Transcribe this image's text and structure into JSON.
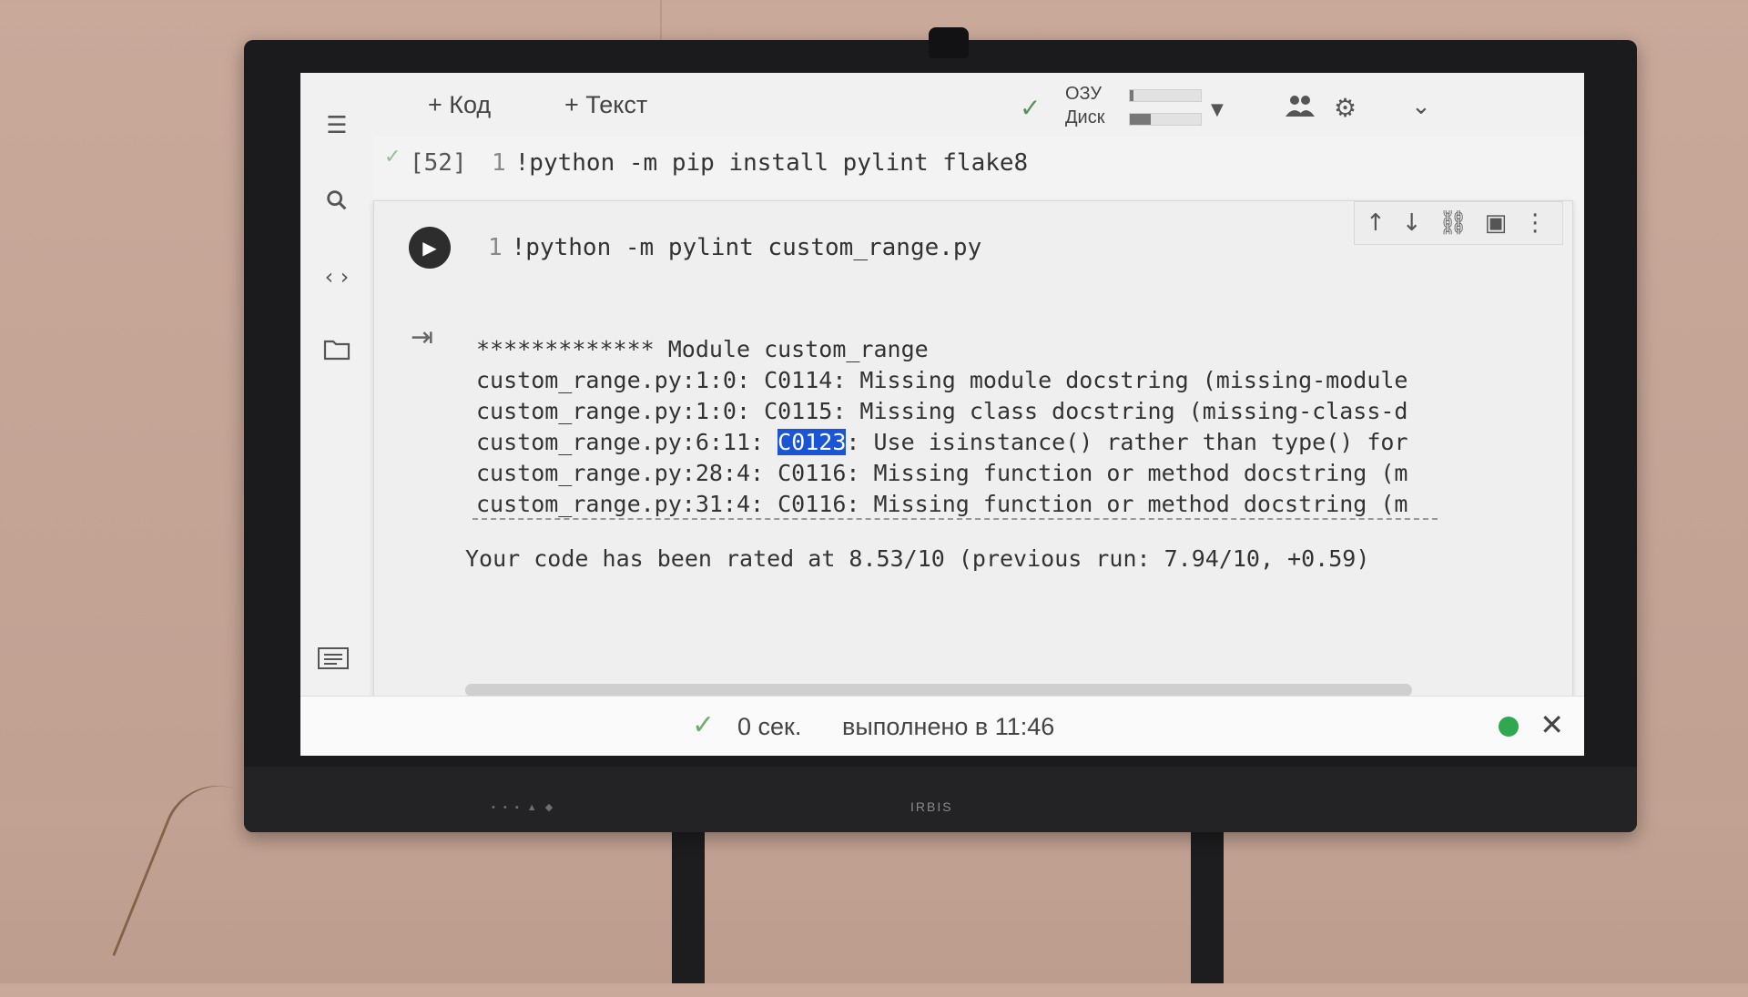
{
  "toolbar": {
    "add_code": "+ Код",
    "add_text": "+ Текст",
    "ram_label": "ОЗУ",
    "disk_label": "Диск",
    "ram_usage": 0.05,
    "disk_usage": 0.3
  },
  "cells": {
    "install": {
      "exec_count": "[52]",
      "line_no": "1",
      "code": "!python -m pip install pylint flake8"
    },
    "pylint": {
      "line_no": "1",
      "code": "!python -m pylint custom_range.py",
      "output": {
        "header": "************* Module custom_range",
        "lines": [
          "custom_range.py:1:0: C0114: Missing module docstring (missing-module",
          "custom_range.py:1:0: C0115: Missing class docstring (missing-class-d",
          "custom_range.py:28:4: C0116: Missing function or method docstring (m",
          "custom_range.py:31:4: C0116: Missing function or method docstring (m"
        ],
        "hl_line": {
          "prefix": "custom_range.py:6:11: ",
          "highlight": "C0123",
          "suffix": ": Use isinstance() rather than type() for"
        },
        "rating": "Your code has been rated at 8.53/10 (previous run: 7.94/10, +0.59)"
      }
    }
  },
  "statusbar": {
    "elapsed": "0 сек.",
    "completed": "выполнено в 11:46",
    "status_color": "#2fa84f"
  },
  "tv": {
    "brand": "IRBIS"
  }
}
